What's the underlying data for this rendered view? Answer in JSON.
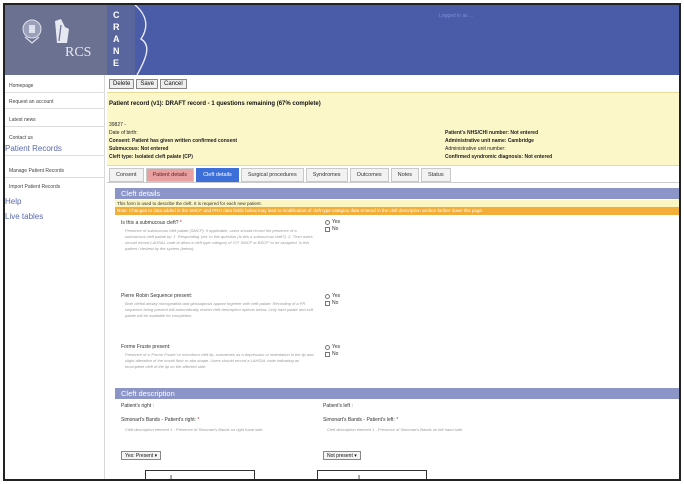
{
  "header": {
    "logo_text": "RCS",
    "crane_letters": [
      "C",
      "R",
      "A",
      "N",
      "E"
    ],
    "top_link": "Logged in as ..."
  },
  "sidebar": {
    "items": [
      {
        "label": "Homepage"
      },
      {
        "label": "Request an account"
      },
      {
        "label": "Latest news"
      },
      {
        "label": "Contact us"
      }
    ],
    "section_patient": "Patient Records",
    "patient_items": [
      {
        "label": "Manage Patient Records"
      },
      {
        "label": "Import Patient Records"
      }
    ],
    "help": "Help",
    "live_tables": "Live tables"
  },
  "toolbar": {
    "delete_label": "Delete",
    "save_label": "Save",
    "cancel_label": "Cancel"
  },
  "record": {
    "title": "Patient record (v1): DRAFT record - 1 questions remaining (67% complete)",
    "id": "39827 -",
    "dob": "Date of birth:",
    "consent": "Consent: Patient has given written confirmed consent",
    "submucous": "Submucous: Not entered",
    "cleft_type": "Cleft type: Isolated cleft palate (CP)",
    "nhs": "Patient's NHS/CHI number: Not entered",
    "admin_unit_name": "Administrative unit name: Cambridge",
    "admin_unit_number": "Administrative unit number:",
    "syndromic": "Confirmed syndromic diagnosis: Not entered"
  },
  "tabs": [
    {
      "label": "Consent",
      "style": "normal"
    },
    {
      "label": "Patient details",
      "style": "pink"
    },
    {
      "label": "Cleft details",
      "style": "active"
    },
    {
      "label": "Surgical procedures",
      "style": "normal"
    },
    {
      "label": "Syndromes",
      "style": "normal"
    },
    {
      "label": "Outcomes",
      "style": "normal"
    },
    {
      "label": "Notes",
      "style": "normal"
    },
    {
      "label": "Status",
      "style": "normal"
    }
  ],
  "cleft_details": {
    "heading": "Cleft details",
    "info": "This form is used to describe the cleft. It is required for each new patient.",
    "note": "Note: Changes to data added in the SMCP and PRO data fields below may lead to modification of cleft type category data entered in the cleft description section further down this page.",
    "questions": [
      {
        "label": "Is this a submucous cleft?",
        "required": "*",
        "help": "Presence of submucous cleft palate (SMCP). If applicable, users should record the presence of a submucous cleft palate by: 1. Responding 'yes' to this question (Is this a submucous cleft?). 2. Then users should record LAHSAL code to allow a cleft type category of 'CP, SMCP or BSCP' to be assigned. Is this patient / desired by the system (below).",
        "options": [
          "Yes",
          "No"
        ],
        "control": "checkbox"
      },
      {
        "label": "Pierre Robin Sequence present:",
        "required": "",
        "help": "Both cleftal airway micrognathia and glossoptosis appear together with cleft palate. Recording of a PR sequence being present will automatically restrict cleft description options below. Only hard palate and soft palate will be available for completion.",
        "options": [
          "Yes",
          "No"
        ],
        "control": "radio"
      },
      {
        "label": "Forme Fruste present:",
        "required": "",
        "help": "Presence of a 'Forme Fruste' or microform cleft lip, sometimes as a depression or indentation in the lip and slight alteration of the nostril floor or alar shape. Users should record a LAHSAL code indicating an incomplete cleft of the lip on the affected side.",
        "options": [
          "Yes",
          "No"
        ],
        "control": "radio"
      }
    ]
  },
  "cleft_description": {
    "heading": "Cleft description",
    "right_heading": "Patient's right :",
    "left_heading": "Patient's left :",
    "right_label": "Simonart's Bands - Patient's right:",
    "left_label": "Simonart's Bands - Patient's left:",
    "required": "*",
    "right_help": "Cleft description element 1 - Presence of Simonart's Bands on right hand side.",
    "left_help": "Cleft description element 1 - Presence of Simonart's Bands on left hand side.",
    "right_value": "Yes: Present",
    "left_value": "Not present",
    "diagram_letters": [
      "L",
      "L"
    ]
  },
  "colors": {
    "header_bg": "#4a5ba8",
    "record_bg": "#fcf7c9",
    "active_tab": "#3d6fd8",
    "section_head": "#8b95c8",
    "note_bar": "#f3ae3a"
  }
}
